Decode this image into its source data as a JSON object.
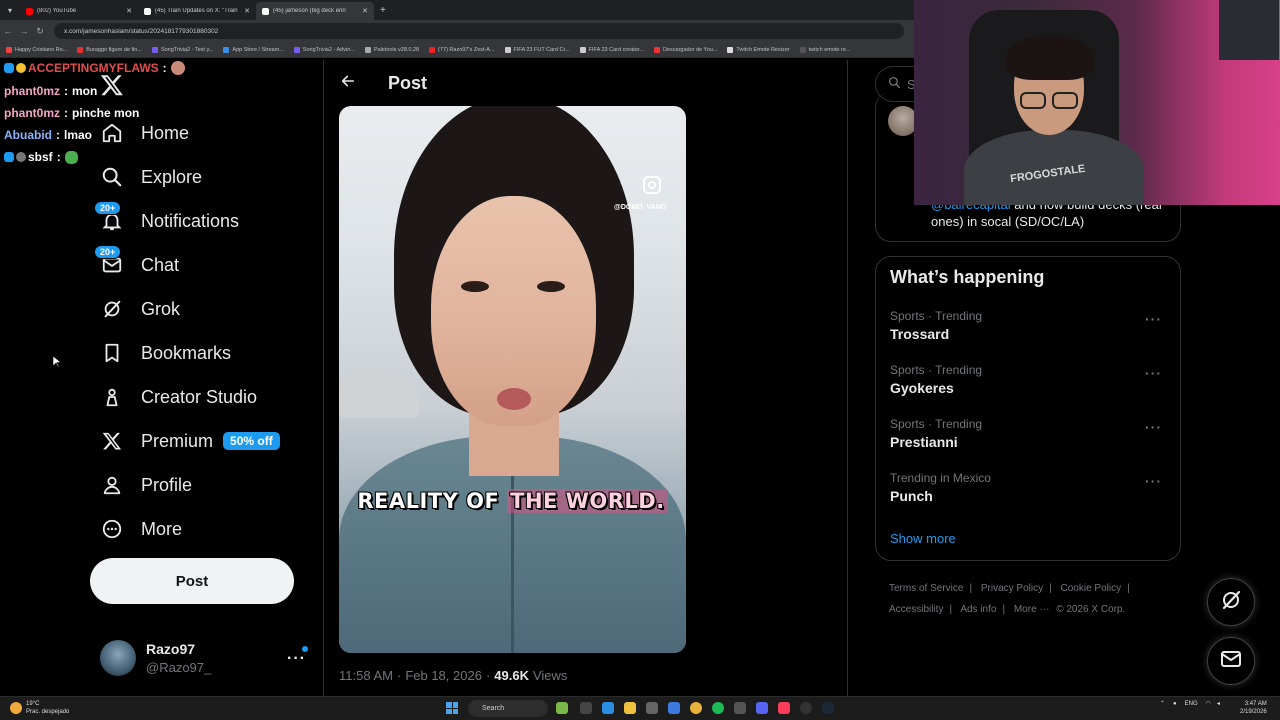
{
  "browser": {
    "tabs": [
      {
        "title": "(802) YouTube",
        "color": "#ff0000"
      },
      {
        "title": "(45) Train Updates on X: \"Train",
        "color": "#ffffff"
      },
      {
        "title": "(45) jameson (big deck enn",
        "color": "#ffffff",
        "active": true
      }
    ],
    "url": "x.com/jamesonhaslam/status/2024181779301880302",
    "bookmarks": [
      "Happy Cristiano Ro...",
      "Buraggo figure de fin...",
      "SongTrivia2 - Test y...",
      "App Store / Stream...",
      "SongTrivia2 - Advin...",
      "Paletools v28.0.28",
      "(77) Razo97's Zest-A...",
      "FIFA 23 FUT Card Cr...",
      "FIFA 23 Card creator...",
      "Descargador de You...",
      "Twitch Emote Resizer",
      "twitch emote re..."
    ]
  },
  "chat": [
    {
      "user": "ACCEPTINGMYFLAWS",
      "sep": ":",
      "msg": ""
    },
    {
      "user": "phant0mz",
      "sep": ":",
      "msg": "mon"
    },
    {
      "user": "phant0mz",
      "sep": ":",
      "msg": "pinche mon"
    },
    {
      "user": "Abuabid",
      "sep": ":",
      "msg": "lmao"
    },
    {
      "user": "sbsf",
      "sep": ":",
      "msg": ""
    }
  ],
  "nav": {
    "items": [
      {
        "label": "Home",
        "icon": "home-icon"
      },
      {
        "label": "Explore",
        "icon": "search-icon"
      },
      {
        "label": "Notifications",
        "icon": "bell-icon",
        "badge": "20+"
      },
      {
        "label": "Chat",
        "icon": "mail-icon",
        "badge": "20+"
      },
      {
        "label": "Grok",
        "icon": "grok-icon"
      },
      {
        "label": "Bookmarks",
        "icon": "bookmark-icon"
      },
      {
        "label": "Creator Studio",
        "icon": "creator-studio-icon"
      },
      {
        "label": "Premium",
        "icon": "x-logo-icon",
        "pill": "50% off"
      },
      {
        "label": "Profile",
        "icon": "person-icon"
      },
      {
        "label": "More",
        "icon": "more-circle-icon"
      }
    ],
    "post_button": "Post",
    "account": {
      "name": "Razo97",
      "handle": "@Razo97_"
    }
  },
  "post": {
    "header_title": "Post",
    "video": {
      "caption_part1": "REALITY OF ",
      "caption_highlight": "THE WORLD.",
      "watermark_handle": "@DOMO_VANG"
    },
    "meta": {
      "time": "11:58 AM",
      "dot1": "·",
      "date": "Feb 18, 2026",
      "dot2": "·",
      "views_count": "49.6K",
      "views_label": "Views"
    }
  },
  "right": {
    "search_placeholder": "Se",
    "recommended_text_mention": "@bairecapital",
    "recommended_text": " and how build decks (real ones) in socal (SD/OC/LA)",
    "happening_title": "What’s happening",
    "trends": [
      {
        "category": "Sports · Trending",
        "name": "Trossard"
      },
      {
        "category": "Sports · Trending",
        "name": "Gyokeres"
      },
      {
        "category": "Sports · Trending",
        "name": "Prestianni"
      },
      {
        "category": "Trending in Mexico",
        "name": "Punch"
      }
    ],
    "show_more": "Show more",
    "footer": {
      "terms": "Terms of Service",
      "privacy": "Privacy Policy",
      "cookie": "Cookie Policy",
      "accessibility": "Accessibility",
      "ads": "Ads info",
      "more": "More ···",
      "copyright": "© 2026 X Corp."
    }
  },
  "webcam": {
    "shirt_text": "FROGOSTALE"
  },
  "taskbar": {
    "weather_temp": "19°C",
    "weather_desc": "Prac. despejado",
    "search_label": "Search",
    "lang": "ENG",
    "time": "3:47 AM",
    "date": "2/19/2026"
  },
  "colors": {
    "accent": "#1d9bf0",
    "background": "#000000",
    "border": "#2f3336",
    "secondary_text": "#71767b"
  }
}
